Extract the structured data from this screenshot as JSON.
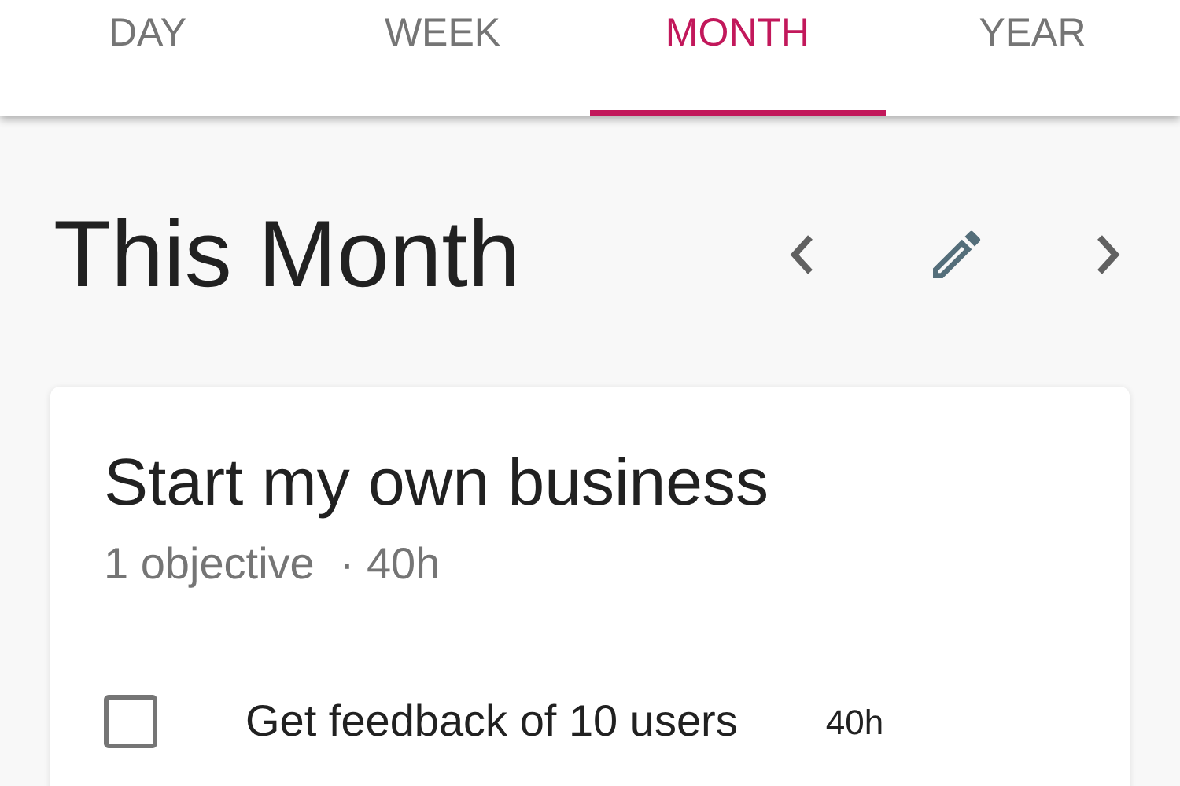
{
  "tabs": [
    {
      "label": "DAY",
      "selected": false
    },
    {
      "label": "WEEK",
      "selected": false
    },
    {
      "label": "MONTH",
      "selected": true
    },
    {
      "label": "YEAR",
      "selected": false
    }
  ],
  "heading": "This Month",
  "goal": {
    "title": "Start my own business",
    "objectives": "1 objective",
    "hours": "· 40h",
    "items": [
      {
        "label": "Get feedback of 10 users",
        "hours": "40h",
        "checked": false
      }
    ]
  }
}
